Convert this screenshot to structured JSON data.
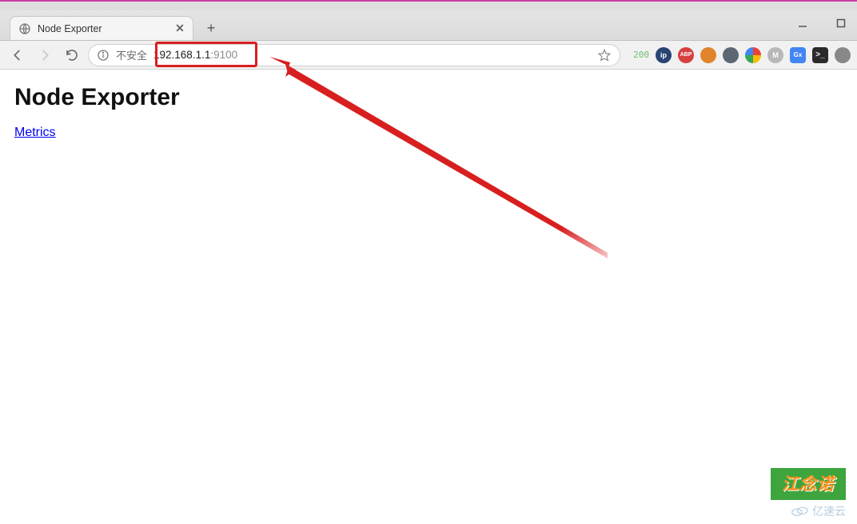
{
  "window": {
    "minimize": "—",
    "maximize": "▢"
  },
  "tab": {
    "title": "Node Exporter"
  },
  "nav": {
    "back": "back",
    "forward": "forward",
    "reload": "reload"
  },
  "address": {
    "security_label": "不安全",
    "url_host": "192.168.1.1",
    "url_port": ":9100"
  },
  "extensions": {
    "status_code": "200",
    "ip": "ip",
    "abp": "ABP",
    "m": "M",
    "translate": "Gx",
    "term": ">_"
  },
  "page": {
    "heading": "Node Exporter",
    "link_text": "Metrics"
  },
  "watermark": {
    "text1": "江念诺",
    "text2": "亿速云"
  }
}
